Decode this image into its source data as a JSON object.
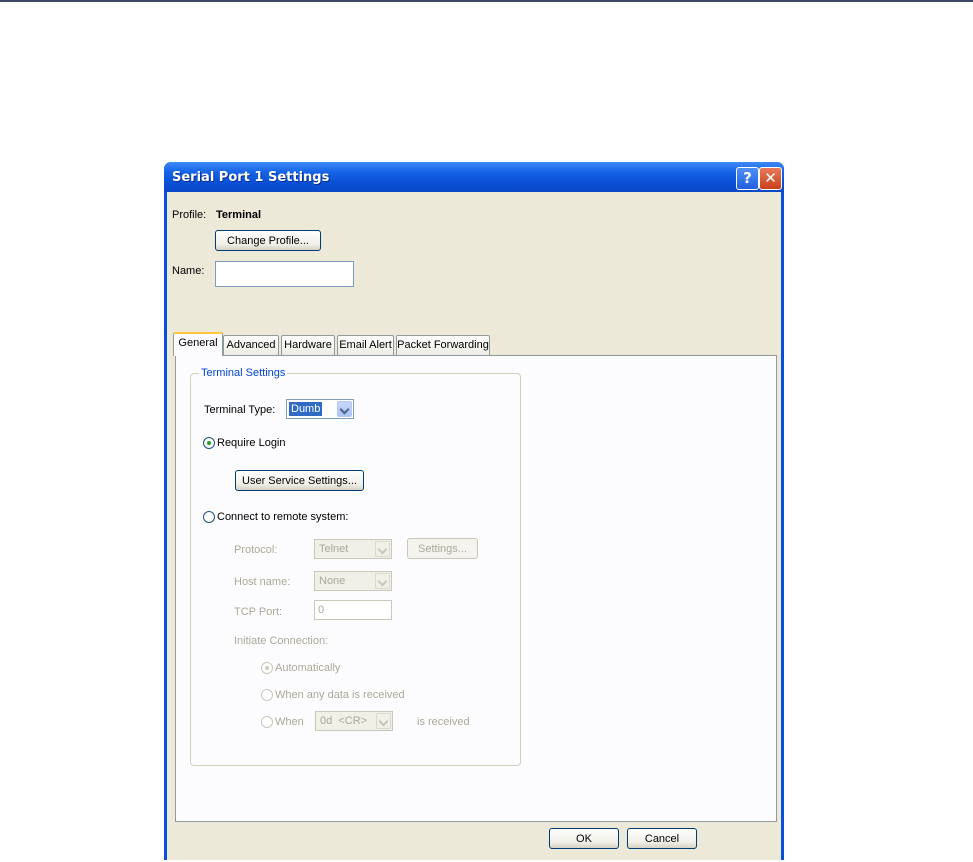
{
  "window": {
    "title": "Serial Port 1 Settings",
    "help_label": "?",
    "close_label": "✕"
  },
  "profile": {
    "label": "Profile:",
    "value": "Terminal",
    "change_button": "Change Profile..."
  },
  "name": {
    "label": "Name:",
    "value": ""
  },
  "tabs": [
    {
      "label": "General",
      "active": true
    },
    {
      "label": "Advanced"
    },
    {
      "label": "Hardware"
    },
    {
      "label": "Email Alert"
    },
    {
      "label": "Packet Forwarding"
    }
  ],
  "terminal_settings": {
    "group_title": "Terminal Settings",
    "type_label": "Terminal Type:",
    "type_value": "Dumb",
    "require_login": "Require Login",
    "user_service_button": "User Service Settings...",
    "connect_remote": "Connect to remote system:",
    "protocol_label": "Protocol:",
    "protocol_value": "Telnet",
    "settings_button": "Settings...",
    "host_label": "Host name:",
    "host_value": "None",
    "tcp_label": "TCP Port:",
    "tcp_value": "0",
    "initiate_label": "Initiate Connection:",
    "auto_label": "Automatically",
    "any_data_label": "When any data is received",
    "when_label": "When",
    "when_value": "0d  <CR>",
    "received_label": "is received"
  },
  "footer": {
    "ok": "OK",
    "cancel": "Cancel"
  },
  "colors": {
    "titlebar": "#0a50d6",
    "dialog_bg": "#ece9d8",
    "group_title": "#0046d5",
    "active_tab_accent": "#ffc83c"
  }
}
